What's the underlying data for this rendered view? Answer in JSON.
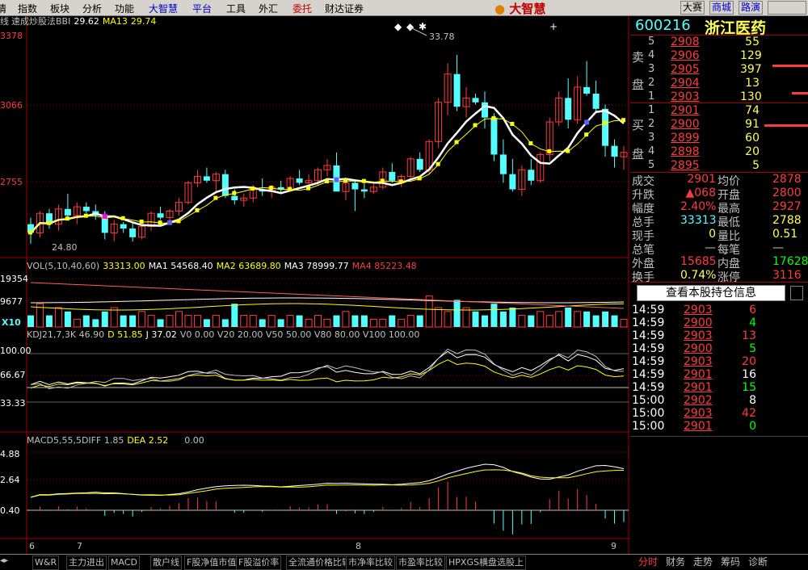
{
  "menu": {
    "items": [
      "情",
      "指数",
      "板块",
      "分析",
      "功能",
      "大智慧",
      "平台",
      "工具",
      "外汇",
      "委托",
      "财达证券"
    ],
    "logo": "大智慧",
    "right_buttons": [
      "大赛",
      "商城",
      "路演"
    ]
  },
  "chart": {
    "indicator_line": {
      "prefix": "线",
      "name": "速成炒股法BBI",
      "v1": "29.62",
      "ma_label": "MA13",
      "v2": "29.74"
    },
    "price_axis": [
      "3378",
      "3066",
      "2755"
    ],
    "high_label": "33.78",
    "low_label": "24.80",
    "vol_line": {
      "name": "VOL(5,10,40,60)",
      "v": "33313.00",
      "ma1": "MA1 54568.40",
      "ma2": "MA2 63689.80",
      "ma3": "MA3 78999.77",
      "ma4": "MA4 85223.48"
    },
    "vol_axis": [
      "19354",
      "9677",
      "X10"
    ],
    "kdj_line": {
      "name": "KDJ21,7,3K 46.90",
      "d": "D 51.85",
      "j": "J 37.02",
      "rest": "V0 0.00 V20 20.00 V50 50.00 V80 80.00 V100 100.00"
    },
    "kdj_axis": [
      "100.00",
      "66.67",
      "33.33"
    ],
    "macd_line": {
      "name": "MACD5,55,5DIFF 1.85",
      "dea": "DEA 2.52",
      "z": "0.00"
    },
    "macd_axis": [
      "4.88",
      "2.64",
      "0.40"
    ],
    "date_axis": [
      "6",
      "7",
      "8",
      "9"
    ]
  },
  "quote": {
    "code": "600216",
    "name": "浙江医药",
    "sell_label": [
      "卖",
      "盘"
    ],
    "buy_label": [
      "买",
      "盘"
    ],
    "sells": [
      [
        "5",
        "2908",
        "55"
      ],
      [
        "4",
        "2906",
        "129"
      ],
      [
        "3",
        "2905",
        "397"
      ],
      [
        "2",
        "2904",
        "13"
      ],
      [
        "1",
        "2903",
        "130"
      ]
    ],
    "buys": [
      [
        "1",
        "2901",
        "74"
      ],
      [
        "2",
        "2900",
        "91"
      ],
      [
        "3",
        "2899",
        "60"
      ],
      [
        "4",
        "2898",
        "20"
      ],
      [
        "5",
        "2895",
        "5"
      ]
    ],
    "stats": [
      [
        "成交",
        "2901",
        "均价",
        "2878"
      ],
      [
        "升跌",
        "▲068",
        "开盘",
        "2800"
      ],
      [
        "幅度",
        "2.40%",
        "最高",
        "2927"
      ],
      [
        "总手",
        "33313",
        "最低",
        "2788"
      ],
      [
        "现手",
        "0",
        "量比",
        "0.51"
      ],
      [
        "总笔",
        "—",
        "每笔",
        "—"
      ],
      [
        "外盘",
        "15685",
        "内盘",
        "17628"
      ],
      [
        "换手",
        "0.74%",
        "涨停",
        "3116"
      ]
    ],
    "holdings_button": "查看本股持仓信息",
    "ticks": [
      [
        "14:59",
        "2903",
        "6"
      ],
      [
        "14:59",
        "2900",
        "4"
      ],
      [
        "14:59",
        "2903",
        "13"
      ],
      [
        "14:59",
        "2900",
        "5"
      ],
      [
        "14:59",
        "2903",
        "20"
      ],
      [
        "14:59",
        "2901",
        "16"
      ],
      [
        "14:59",
        "2901",
        "15"
      ],
      [
        "15:00",
        "2902",
        "8"
      ],
      [
        "15:00",
        "2903",
        "42"
      ],
      [
        "15:00",
        "2901",
        "0"
      ]
    ]
  },
  "tabs": [
    "W&R",
    "主力进出",
    "MACD",
    "散户线",
    "F股净值市值",
    "F股溢价率",
    "全流通价格比较",
    "市净率比较",
    "市盈率比较",
    "HPXGS横盘选股上"
  ],
  "right_tabs": [
    "分时",
    "财务",
    "走势",
    "筹码",
    "诊断"
  ]
}
